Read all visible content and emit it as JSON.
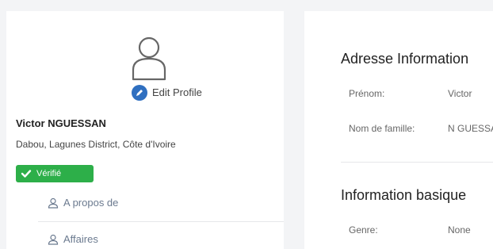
{
  "profile": {
    "edit_label": "Edit Profile",
    "name": "Victor NGUESSAN",
    "location": "Dabou, Lagunes District, Côte d'Ivoire",
    "verified_label": "Vérifié"
  },
  "sidebar": {
    "items": [
      {
        "label": "A propos de",
        "icon": "user-icon"
      },
      {
        "label": "Affaires",
        "icon": "user-icon"
      }
    ]
  },
  "address": {
    "title": "Adresse Information",
    "fields": [
      {
        "label": "Prénom:",
        "value": "Victor"
      },
      {
        "label": "Nom de famille:",
        "value": "N GUESSAN"
      }
    ]
  },
  "basic": {
    "title": "Information basique",
    "fields": [
      {
        "label": "Genre:",
        "value": "None"
      }
    ]
  },
  "colors": {
    "verified": "#2daf49",
    "edit_badge": "#2f6fc0",
    "background": "#f3f4f6"
  }
}
